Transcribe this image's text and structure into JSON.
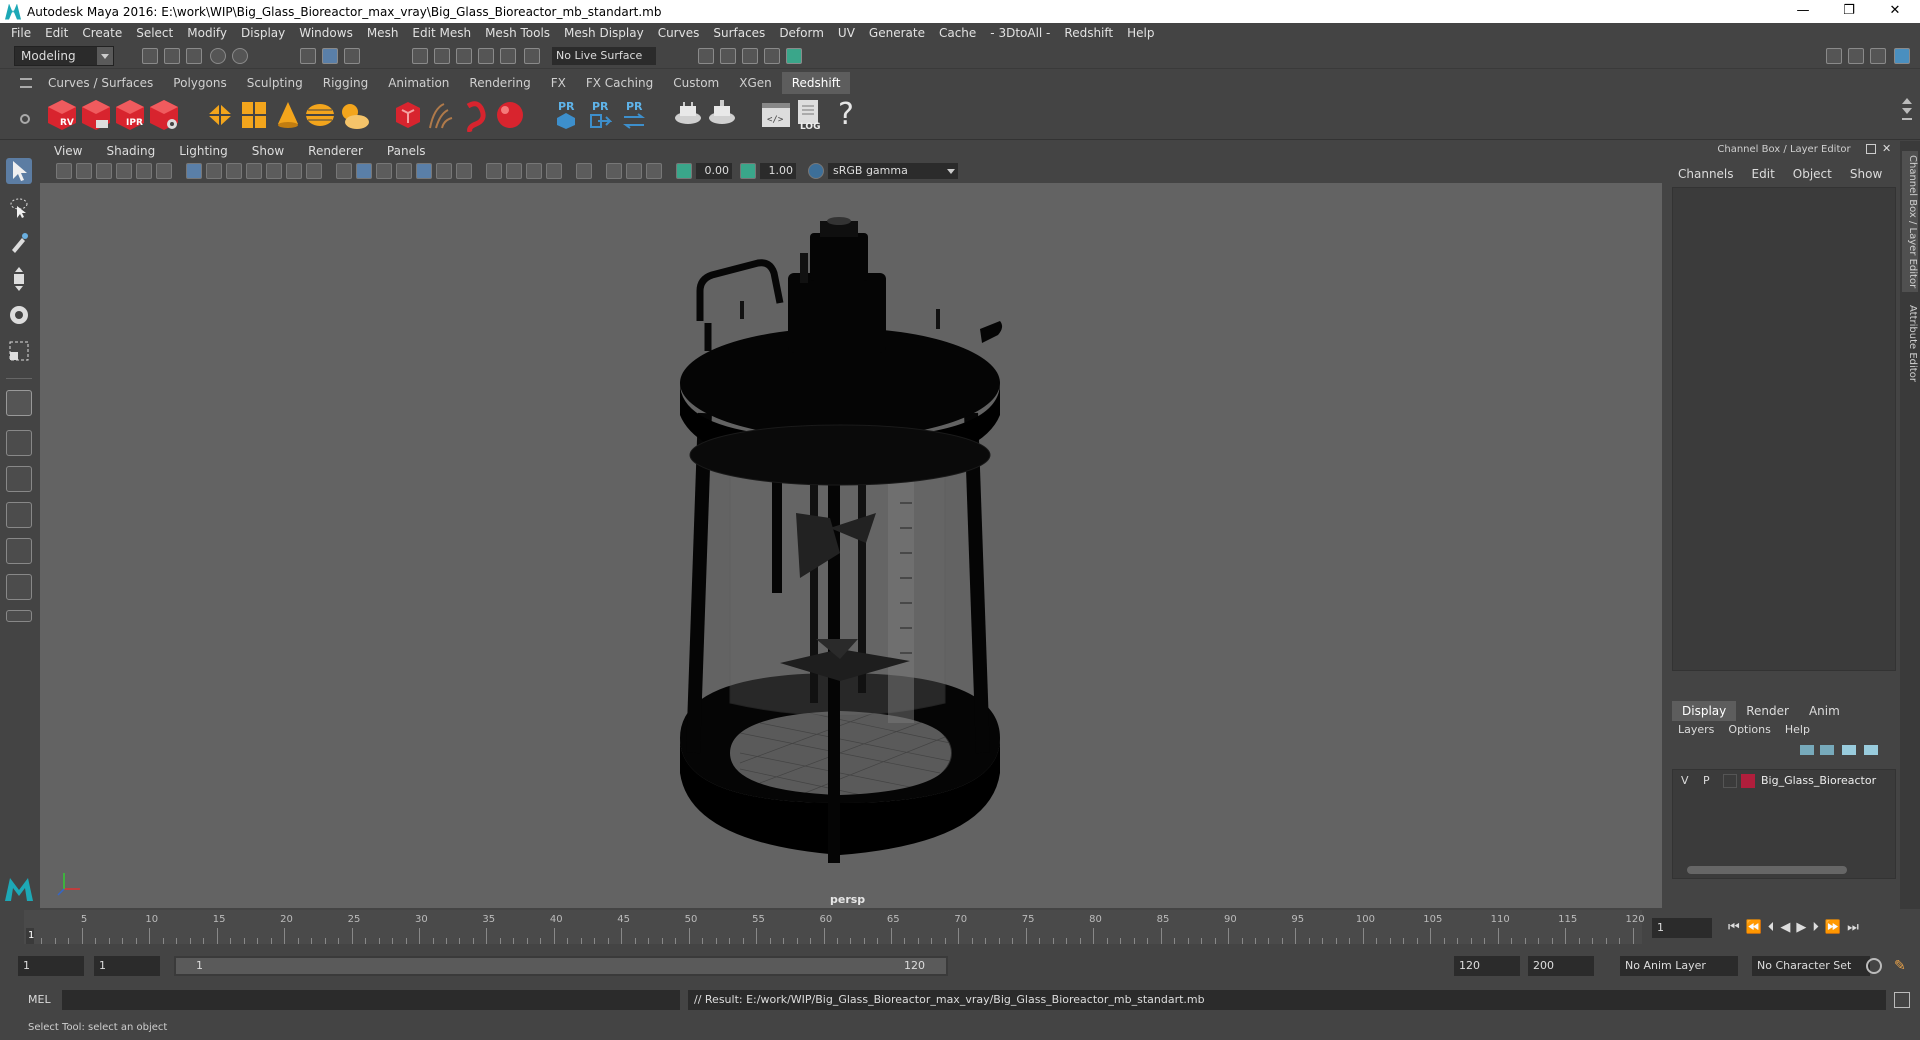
{
  "window": {
    "title": "Autodesk Maya 2016: E:\\work\\WIP\\Big_Glass_Bioreactor_max_vray\\Big_Glass_Bioreactor_mb_standart.mb",
    "minimize": "—",
    "restore": "❐",
    "close": "✕"
  },
  "menubar": [
    "File",
    "Edit",
    "Create",
    "Select",
    "Modify",
    "Display",
    "Windows",
    "Mesh",
    "Edit Mesh",
    "Mesh Tools",
    "Mesh Display",
    "Curves",
    "Surfaces",
    "Deform",
    "UV",
    "Generate",
    "Cache",
    "- 3DtoAll -",
    "Redshift",
    "Help"
  ],
  "statusline": {
    "mode": "Modeling",
    "live_surface": "No Live Surface"
  },
  "shelf": {
    "tabs": [
      "Curves / Surfaces",
      "Polygons",
      "Sculpting",
      "Rigging",
      "Animation",
      "Rendering",
      "FX",
      "FX Caching",
      "Custom",
      "XGen",
      "Redshift"
    ],
    "active_tab": "Redshift",
    "icon_labels": {
      "rv": "RV",
      "ipr": "IPR",
      "pr1": "PR",
      "pr2": "PR",
      "pr3": "PR",
      "log": "LOG",
      "help": "?"
    }
  },
  "viewport": {
    "menu": [
      "View",
      "Shading",
      "Lighting",
      "Show",
      "Renderer",
      "Panels"
    ],
    "exposure": "0.00",
    "gamma": "1.00",
    "color_space": "sRGB gamma",
    "camera": "persp"
  },
  "channel_box": {
    "header": "Channel Box / Layer Editor",
    "menu": [
      "Channels",
      "Edit",
      "Object",
      "Show"
    ]
  },
  "layer_editor": {
    "tabs": [
      "Display",
      "Render",
      "Anim"
    ],
    "active_tab": "Display",
    "menu": [
      "Layers",
      "Options",
      "Help"
    ],
    "layers": [
      {
        "v": "V",
        "p": "P",
        "color": "#b01e3c",
        "name": "Big_Glass_Bioreactor"
      }
    ]
  },
  "side_tabs": [
    "Channel Box / Layer Editor",
    "Attribute Editor"
  ],
  "timeline": {
    "ticks": [
      "5",
      "10",
      "15",
      "20",
      "25",
      "30",
      "35",
      "40",
      "45",
      "50",
      "55",
      "60",
      "65",
      "70",
      "75",
      "80",
      "85",
      "90",
      "95",
      "100",
      "105",
      "110",
      "115",
      "120"
    ],
    "current_frame_label": "1",
    "current_frame": "1"
  },
  "range": {
    "start": "1",
    "playback_start": "1",
    "slider_start": "1",
    "slider_end": "120",
    "playback_end": "120",
    "end": "200",
    "anim_layer": "No Anim Layer",
    "character_set": "No Character Set"
  },
  "command": {
    "lang": "MEL",
    "result": "// Result: E:/work/WIP/Big_Glass_Bioreactor_max_vray/Big_Glass_Bioreactor_mb_standart.mb"
  },
  "help": "Select Tool: select an object"
}
